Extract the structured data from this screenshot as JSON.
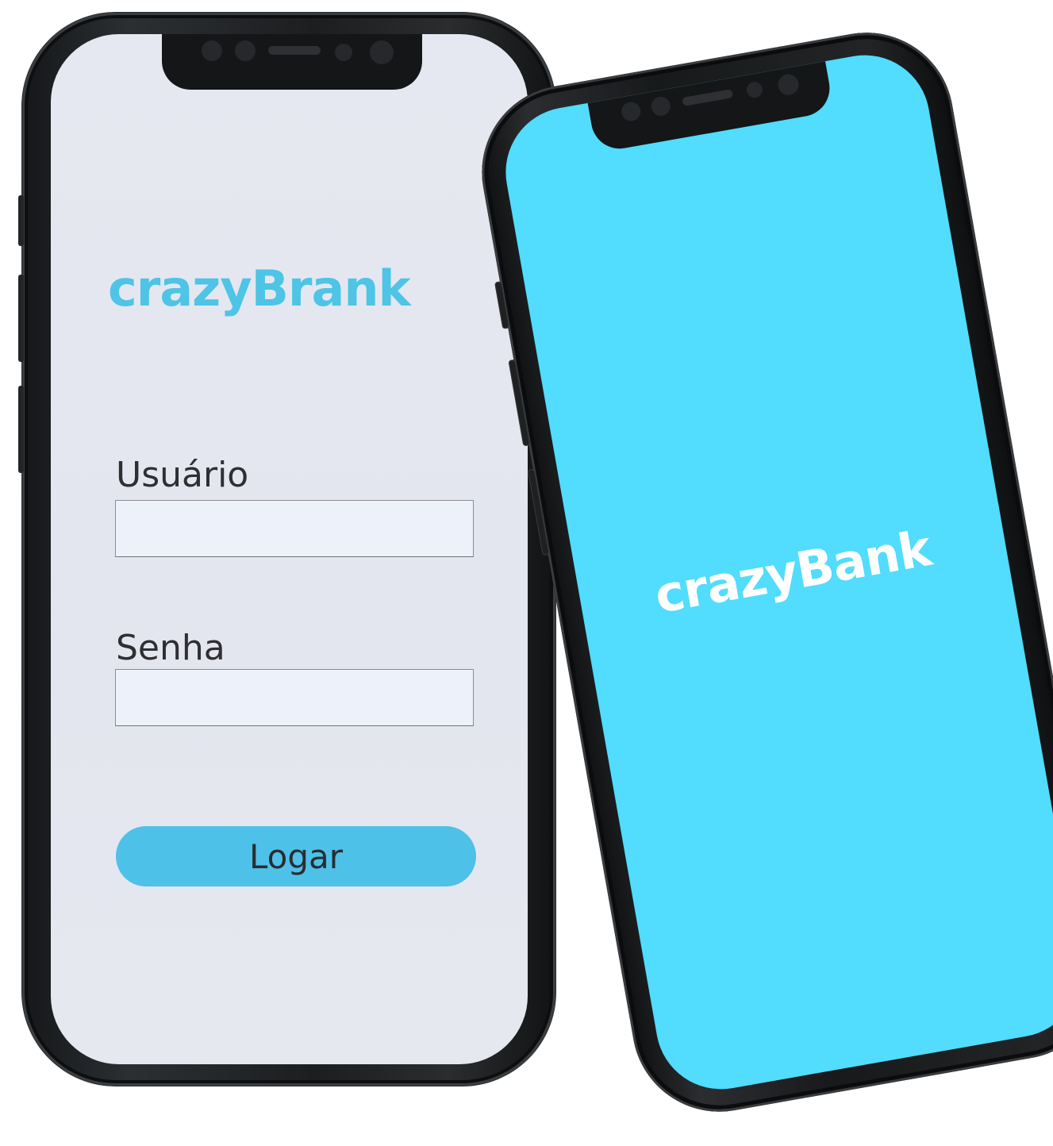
{
  "login_screen": {
    "brand": "crazyBrank",
    "username_label": "Usuário",
    "username_value": "",
    "password_label": "Senha",
    "password_value": "",
    "login_button_label": "Logar"
  },
  "splash_screen": {
    "brand": "crazyBank"
  },
  "colors": {
    "accent": "#4ec4e6",
    "splash_background": "#52dcfd",
    "login_background": "#e5e7f0",
    "input_background": "#edf1fa",
    "phone_frame": "#1c1e20"
  }
}
